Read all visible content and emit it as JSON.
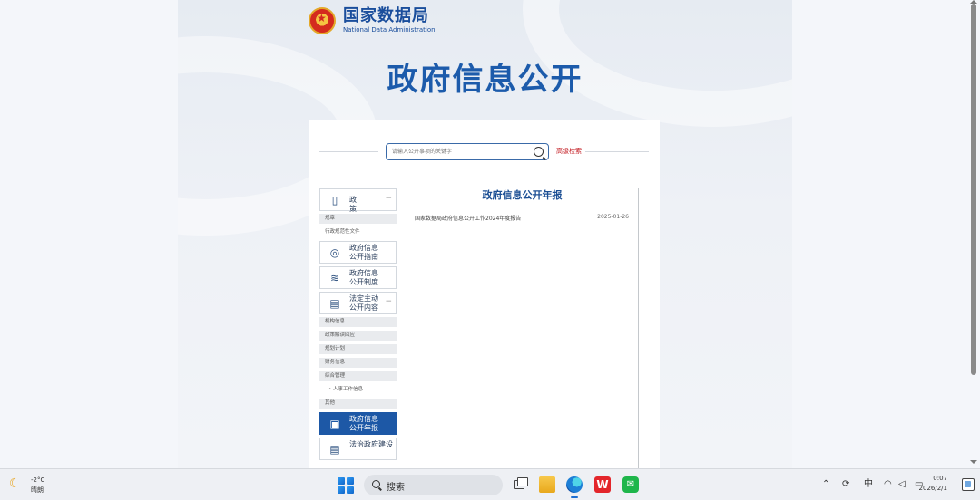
{
  "site": {
    "name_cn": "国家数据局",
    "name_en": "National Data Administration",
    "page_title": "政府信息公开"
  },
  "search": {
    "placeholder": "请输入公开事项的关键字",
    "advanced_label": "高级检索"
  },
  "nav": {
    "policy": "政　策",
    "sub_regulation": "规章",
    "sub_normative": "行政规范性文件",
    "guide": [
      "政府信息",
      "公开指南"
    ],
    "system": [
      "政府信息",
      "公开制度"
    ],
    "statutory": [
      "法定主动",
      "公开内容"
    ],
    "sub_org": "机构信息",
    "sub_policy_interp": "政策解读回应",
    "sub_plan": "规划计划",
    "sub_finance": "财务信息",
    "sub_admin": "综合管理",
    "sub_personnel": "人事工作信息",
    "sub_other": "其他",
    "annual_report": [
      "政府信息",
      "公开年报"
    ],
    "rule_of_law": [
      "法治政府建设"
    ]
  },
  "content": {
    "section_title": "政府信息公开年报",
    "reports": [
      {
        "title": "国家数据局政府信息公开工作2024年度报告",
        "date": "2025-01-26"
      }
    ]
  },
  "taskbar": {
    "weather_temp": "-2°C",
    "weather_cond": "晴朗",
    "search_label": "搜索",
    "ime": "中",
    "time": "0:07",
    "date": "2026/2/1"
  },
  "colors": {
    "brand_blue": "#1c5bab",
    "active_nav": "#1d58a6",
    "advanced_search_red": "#c0131a"
  },
  "icons": [
    "document-icon",
    "compass-icon",
    "layers-icon",
    "clipboard-icon",
    "chart-icon",
    "search-icon",
    "moon-icon",
    "windows-start-icon",
    "task-view-icon",
    "file-explorer-icon",
    "edge-icon",
    "wps-icon",
    "wechat-icon",
    "chevron-up-icon",
    "sync-icon",
    "wifi-icon",
    "volume-icon",
    "battery-icon"
  ]
}
